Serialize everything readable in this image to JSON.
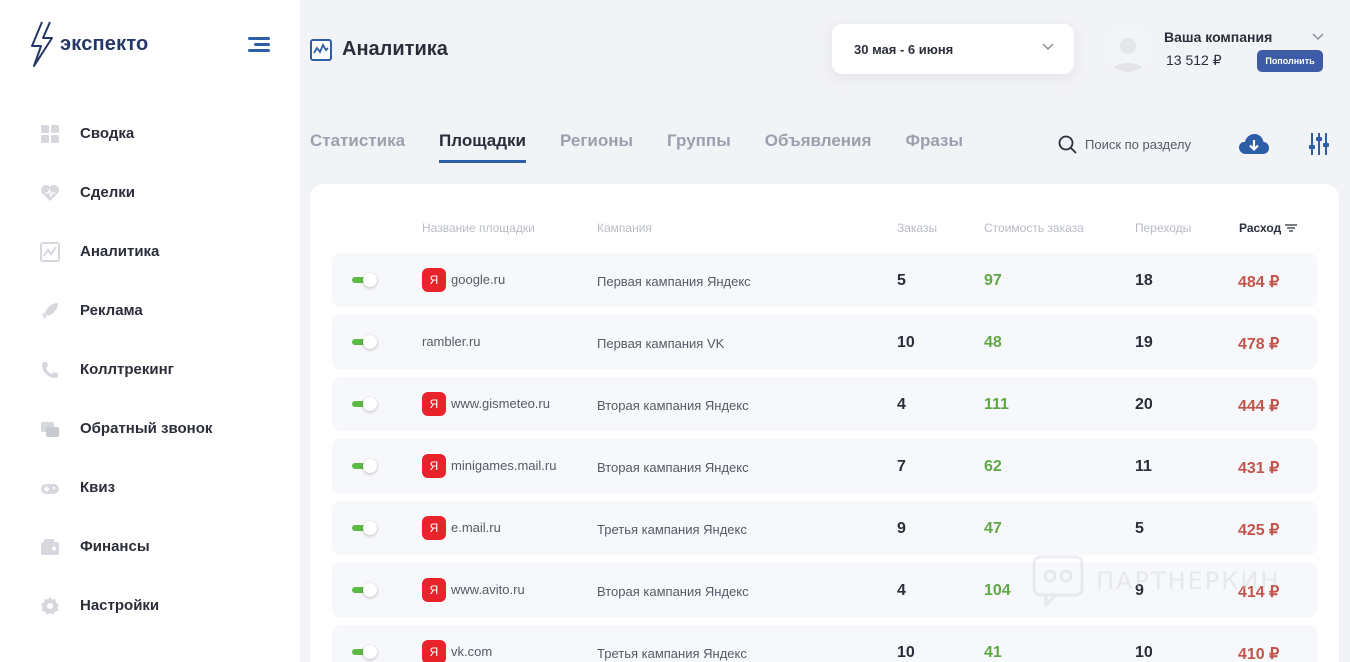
{
  "brand": {
    "name": "экспекто"
  },
  "sidebar": {
    "items": [
      {
        "label": "Сводка",
        "icon": "dashboard-icon"
      },
      {
        "label": "Сделки",
        "icon": "heart-handshake-icon"
      },
      {
        "label": "Аналитика",
        "icon": "analytics-icon"
      },
      {
        "label": "Реклама",
        "icon": "rocket-icon"
      },
      {
        "label": "Коллтрекинг",
        "icon": "phone-icon"
      },
      {
        "label": "Обратный звонок",
        "icon": "callback-icon"
      },
      {
        "label": "Квиз",
        "icon": "gamepad-icon"
      },
      {
        "label": "Финансы",
        "icon": "wallet-icon"
      },
      {
        "label": "Настройки",
        "icon": "gear-icon"
      }
    ]
  },
  "header": {
    "title": "Аналитика",
    "date_range": "30 мая - 6 июня",
    "company": "Ваша компания",
    "balance": "13 512 ₽",
    "topup_label": "Пополнить"
  },
  "tabs": [
    {
      "label": "Статистика",
      "active": false
    },
    {
      "label": "Площадки",
      "active": true
    },
    {
      "label": "Регионы",
      "active": false
    },
    {
      "label": "Группы",
      "active": false
    },
    {
      "label": "Объявления",
      "active": false
    },
    {
      "label": "Фразы",
      "active": false
    }
  ],
  "search": {
    "placeholder": "Поиск по разделу"
  },
  "table": {
    "columns": [
      "Название площадки",
      "Кампания",
      "Заказы",
      "Стоимость заказа",
      "Переходы",
      "Расход"
    ],
    "rows": [
      {
        "enabled": true,
        "yandex": true,
        "site": "google.ru",
        "campaign": "Первая кампания Яндекс",
        "orders": "5",
        "cost": "97",
        "clicks": "18",
        "spend": "484 ₽"
      },
      {
        "enabled": true,
        "yandex": false,
        "site": "rambler.ru",
        "campaign": "Первая кампания VK",
        "orders": "10",
        "cost": "48",
        "clicks": "19",
        "spend": "478 ₽"
      },
      {
        "enabled": true,
        "yandex": true,
        "site": "www.gismeteo.ru",
        "campaign": "Вторая кампания Яндекс",
        "orders": "4",
        "cost": "111",
        "clicks": "20",
        "spend": "444 ₽"
      },
      {
        "enabled": true,
        "yandex": true,
        "site": "minigames.mail.ru",
        "campaign": "Вторая кампания Яндекс",
        "orders": "7",
        "cost": "62",
        "clicks": "11",
        "spend": "431 ₽"
      },
      {
        "enabled": true,
        "yandex": true,
        "site": "e.mail.ru",
        "campaign": "Третья кампания Яндекс",
        "orders": "9",
        "cost": "47",
        "clicks": "5",
        "spend": "425 ₽"
      },
      {
        "enabled": true,
        "yandex": true,
        "site": "www.avito.ru",
        "campaign": "Вторая кампания Яндекс",
        "orders": "4",
        "cost": "104",
        "clicks": "9",
        "spend": "414 ₽"
      },
      {
        "enabled": true,
        "yandex": true,
        "site": "vk.com",
        "campaign": "Третья кампания Яндекс",
        "orders": "10",
        "cost": "41",
        "clicks": "10",
        "spend": "410 ₽"
      }
    ]
  },
  "yandex_badge": "Я",
  "watermark": "ПАРТНЕРКИН",
  "colors": {
    "accent": "#2d5ea8",
    "button": "#3e5ba8",
    "cost": "#5fa845",
    "spend": "#c0564b",
    "yandex": "#e8232b",
    "toggle": "#5db848"
  }
}
